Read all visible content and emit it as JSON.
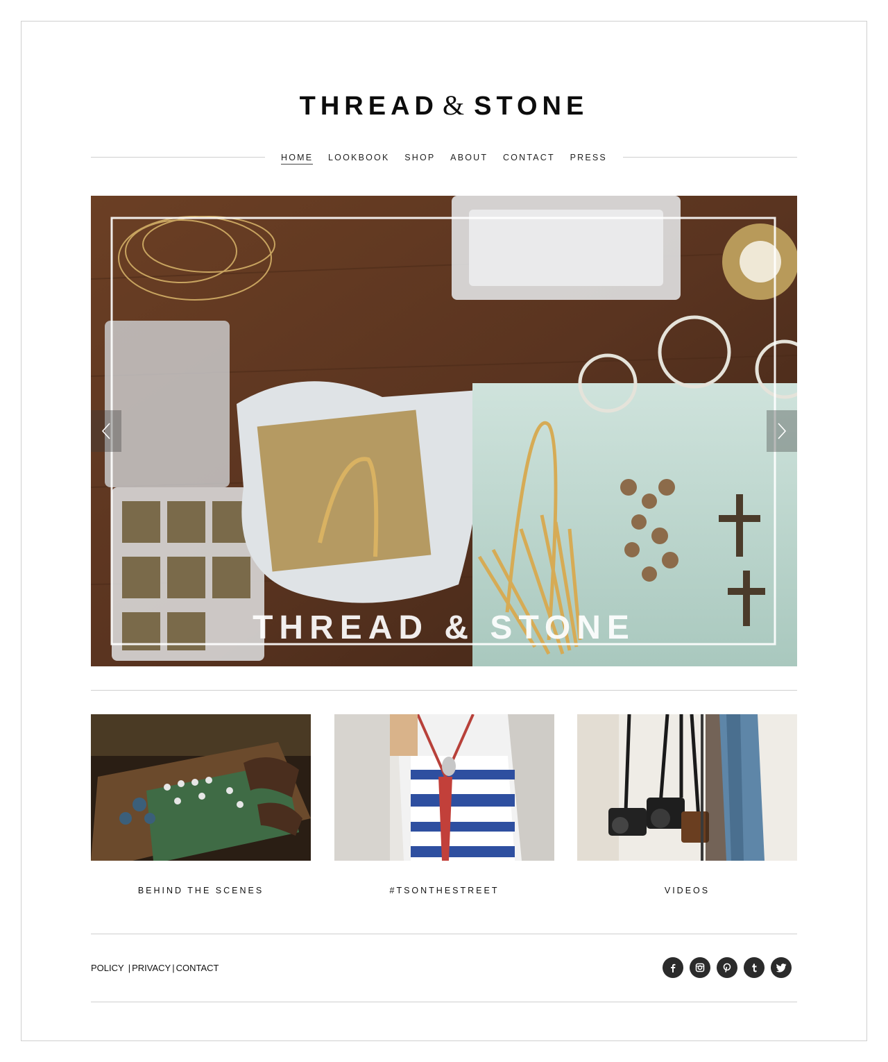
{
  "brand": {
    "name_left": "THREAD",
    "ampersand": "&",
    "name_right": "STONE"
  },
  "nav": {
    "items": [
      {
        "label": "HOME",
        "active": true
      },
      {
        "label": "LOOKBOOK",
        "active": false
      },
      {
        "label": "SHOP",
        "active": false
      },
      {
        "label": "ABOUT",
        "active": false
      },
      {
        "label": "CONTACT",
        "active": false
      },
      {
        "label": "PRESS",
        "active": false
      }
    ]
  },
  "hero": {
    "overlay_text": "THREAD & STONE",
    "image_icon": "jewelry-workbench-photo",
    "prev_icon": "chevron-left-icon",
    "next_icon": "chevron-right-icon"
  },
  "features": [
    {
      "label": "BEHIND THE SCENES",
      "image_icon": "hands-arranging-jewelry-photo"
    },
    {
      "label": "#TSONTHESTREET",
      "image_icon": "model-with-necklace-photo"
    },
    {
      "label": "VIDEOS",
      "image_icon": "hanging-cameras-photo"
    }
  ],
  "footer": {
    "links": [
      "POLICY",
      "PRIVACY",
      "CONTACT"
    ],
    "separator": "|",
    "social": [
      "facebook-icon",
      "instagram-icon",
      "pinterest-icon",
      "tumblr-icon",
      "twitter-icon"
    ]
  },
  "colors": {
    "text": "#111111",
    "rule": "#cfcfcf",
    "social_bg": "#2b2b2b",
    "wood": "#5a3420"
  }
}
